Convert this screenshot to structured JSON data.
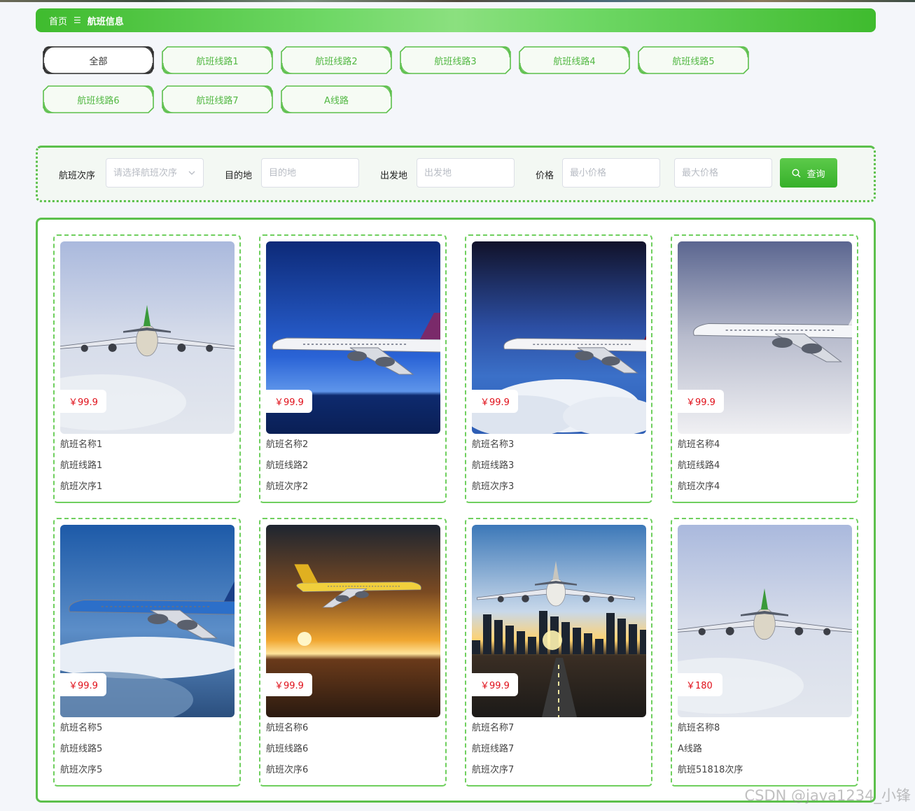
{
  "breadcrumb": {
    "home": "首页",
    "separator": "☰",
    "current": "航班信息"
  },
  "tabs": [
    "全部",
    "航班线路1",
    "航班线路2",
    "航班线路3",
    "航班线路4",
    "航班线路5",
    "航班线路6",
    "航班线路7",
    "A线路"
  ],
  "active_tab": 0,
  "search": {
    "order_label": "航班次序",
    "order_placeholder": "请选择航班次序",
    "dest_label": "目的地",
    "dest_placeholder": "目的地",
    "origin_label": "出发地",
    "origin_placeholder": "出发地",
    "price_label": "价格",
    "min_placeholder": "最小价格",
    "max_placeholder": "最大价格",
    "query_label": "查询"
  },
  "flights": [
    {
      "price": "￥99.9",
      "name": "航班名称1",
      "route": "航班线路1",
      "order": "航班次序1",
      "scene": "sky-light"
    },
    {
      "price": "￥99.9",
      "name": "航班名称2",
      "route": "航班线路2",
      "order": "航班次序2",
      "scene": "deep-blue"
    },
    {
      "price": "￥99.9",
      "name": "航班名称3",
      "route": "航班线路3",
      "order": "航班次序3",
      "scene": "night-clouds"
    },
    {
      "price": "￥99.9",
      "name": "航班名称4",
      "route": "航班线路4",
      "order": "航班次序4",
      "scene": "grey-sky"
    },
    {
      "price": "￥99.9",
      "name": "航班名称5",
      "route": "航班线路5",
      "order": "航班次序5",
      "scene": "blue-clouds"
    },
    {
      "price": "￥99.9",
      "name": "航班名称6",
      "route": "航班线路6",
      "order": "航班次序6",
      "scene": "sunset-sea"
    },
    {
      "price": "￥99.9",
      "name": "航班名称7",
      "route": "航班线路7",
      "order": "航班次序7",
      "scene": "runway-city"
    },
    {
      "price": "￥180",
      "name": "航班名称8",
      "route": "A线路",
      "order": "航班51818次序",
      "scene": "sky-light"
    }
  ],
  "watermark": "CSDN @java1234_小锋",
  "colors": {
    "accent": "#52b843",
    "price": "#e0101a"
  }
}
